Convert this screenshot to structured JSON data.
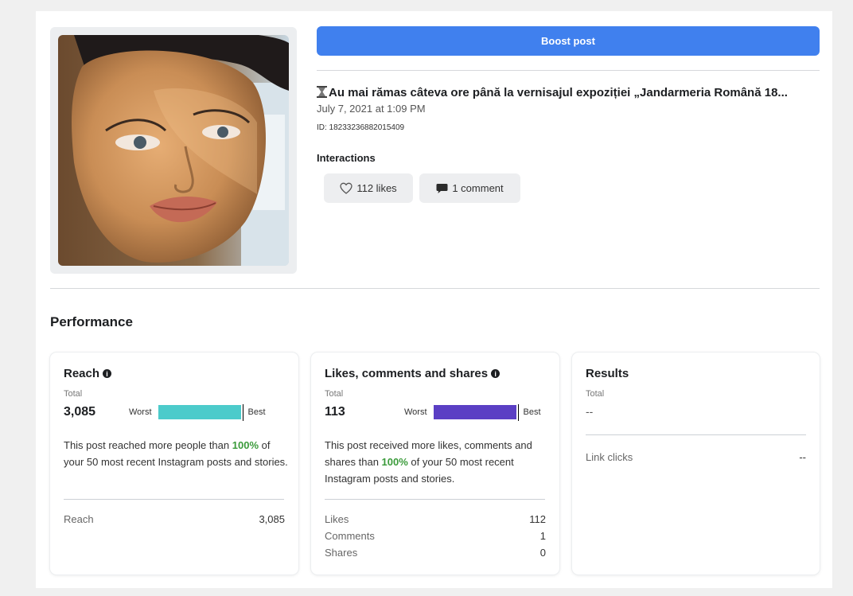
{
  "boost_button": "Boost post",
  "post": {
    "title": "Au mai rămas câteva ore până la vernisajul expoziției „Jandarmeria Română 18...",
    "date": "July 7, 2021 at 1:09 PM",
    "id": "ID: 18233236882015409"
  },
  "interactions": {
    "label": "Interactions",
    "likes": "112 likes",
    "comments": "1 comment"
  },
  "performance": {
    "title": "Performance",
    "reach": {
      "title": "Reach",
      "total_label": "Total",
      "total": "3,085",
      "worst": "Worst",
      "best": "Best",
      "bar_fraction": 1.0,
      "bar_color": "#4ccbcb",
      "desc_pre": "This post reached more people than ",
      "desc_pct": "100%",
      "desc_post": " of your 50 most recent Instagram posts and stories.",
      "rows": [
        {
          "label": "Reach",
          "value": "3,085"
        }
      ]
    },
    "engagement": {
      "title": "Likes, comments and shares",
      "total_label": "Total",
      "total": "113",
      "worst": "Worst",
      "best": "Best",
      "bar_fraction": 1.0,
      "bar_color": "#5b3fc4",
      "desc_pre": "This post received more likes, comments and shares than ",
      "desc_pct": "100%",
      "desc_post": " of your 50 most recent Instagram posts and stories.",
      "rows": [
        {
          "label": "Likes",
          "value": "112"
        },
        {
          "label": "Comments",
          "value": "1"
        },
        {
          "label": "Shares",
          "value": "0"
        }
      ]
    },
    "results": {
      "title": "Results",
      "total_label": "Total",
      "total": "--",
      "rows": [
        {
          "label": "Link clicks",
          "value": "--"
        }
      ]
    }
  },
  "colors": {
    "accent": "#4080ee",
    "positive": "#3b9b3b"
  },
  "icons": [
    "hourglass-icon",
    "heart-outline-icon",
    "comment-bubble-icon",
    "info-icon"
  ]
}
